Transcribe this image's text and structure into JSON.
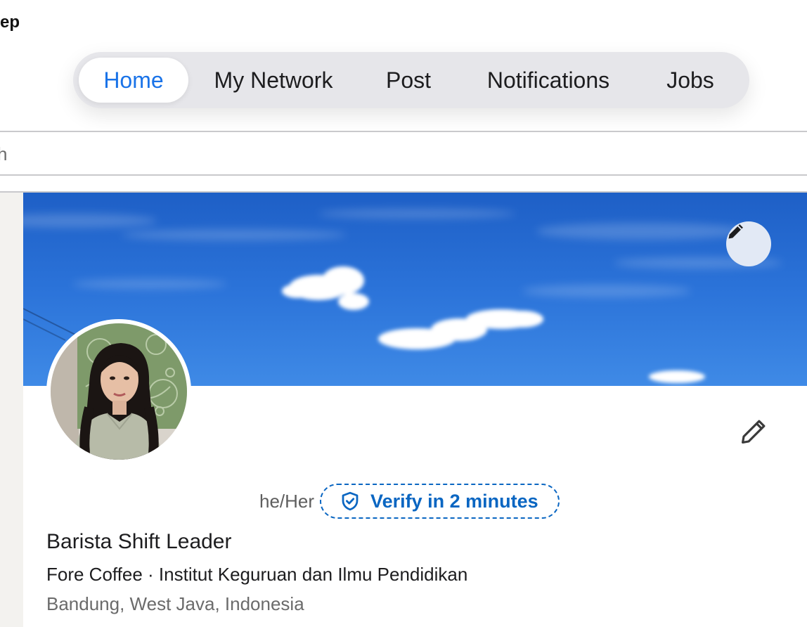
{
  "app": {
    "title_fragment": "ep"
  },
  "tabbar": {
    "tabs": [
      {
        "label": "Home",
        "active": true
      },
      {
        "label": "My Network",
        "active": false
      },
      {
        "label": "Post",
        "active": false
      },
      {
        "label": "Notifications",
        "active": false
      },
      {
        "label": "Jobs",
        "active": false
      }
    ]
  },
  "search": {
    "text_fragment": "h"
  },
  "profile": {
    "pronouns": "he/Her",
    "verify_label": "Verify in 2 minutes",
    "headline": "Barista Shift Leader",
    "company_line": "Fore Coffee · Institut Keguruan dan Ilmu Pendidikan",
    "location": "Bandung, West Java, Indonesia"
  },
  "icons": {
    "banner_edit": "pencil-icon",
    "intro_edit": "pencil-icon",
    "verify": "shield-check-icon"
  },
  "colors": {
    "accent": "#1a73e8",
    "link_blue": "#0a66c2",
    "tabbar_bg": "#e6e6ea",
    "banner_sky": "#2a72d8"
  }
}
